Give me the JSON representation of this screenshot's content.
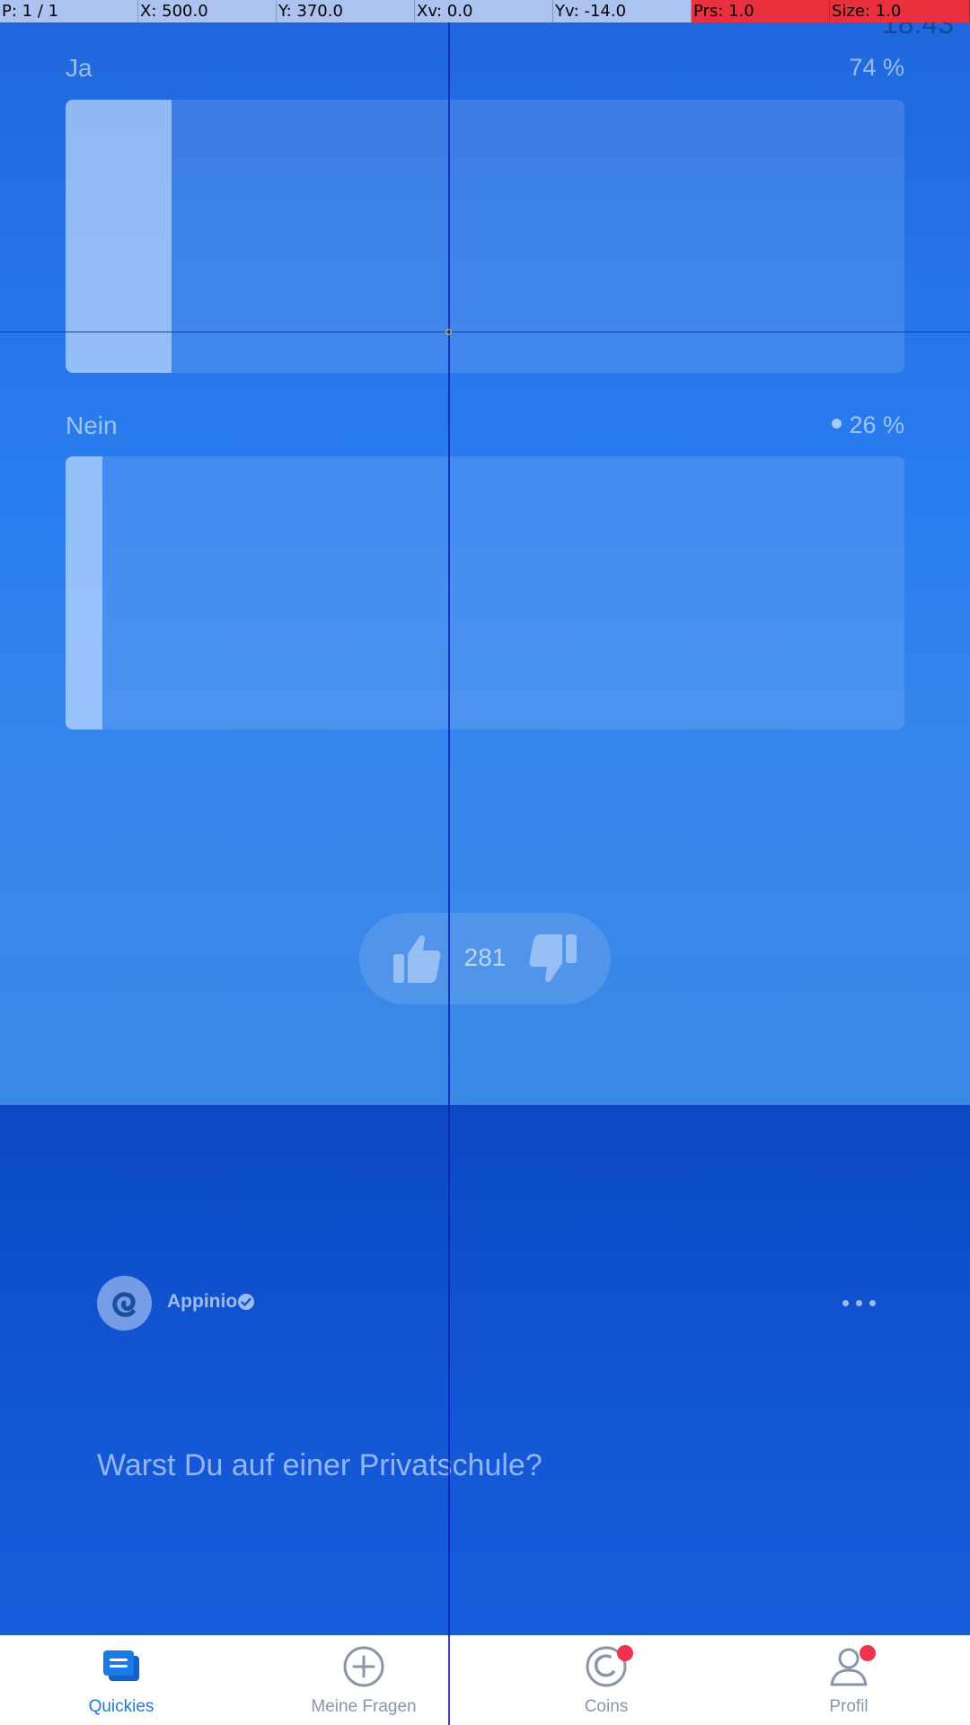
{
  "status_bar": {
    "time": "18:43"
  },
  "results": {
    "options": [
      {
        "label": "Ja",
        "percent_text": "74 %",
        "fill_fraction": 0.126
      },
      {
        "label": "Nein",
        "percent_text": "26 %",
        "fill_fraction": 0.044
      }
    ],
    "votes": {
      "count": "281"
    }
  },
  "question": {
    "author": "Appinio",
    "author_verified": true,
    "text": "Warst Du auf einer Privatschule?"
  },
  "nav": {
    "items": [
      {
        "label": "Quickies",
        "icon": "quickies-icon",
        "active": true,
        "badge": false
      },
      {
        "label": "Meine Fragen",
        "icon": "plus-circle-icon",
        "active": false,
        "badge": false
      },
      {
        "label": "Coins",
        "icon": "coin-icon",
        "active": false,
        "badge": true
      },
      {
        "label": "Profil",
        "icon": "profile-icon",
        "active": false,
        "badge": true
      }
    ]
  },
  "debug": {
    "pointer": "P: 1 / 1",
    "x": "X: 500.0",
    "y": "Y: 370.0",
    "xv": "Xv: 0.0",
    "yv": "Yv: -14.0",
    "prs": "Prs: 1.0",
    "size": "Size: 1.0"
  },
  "colors": {
    "accent": "#1a7ae6",
    "badge": "#f0344d",
    "card_blue": "#1357d6",
    "results_blue": "#2a7ef0"
  }
}
